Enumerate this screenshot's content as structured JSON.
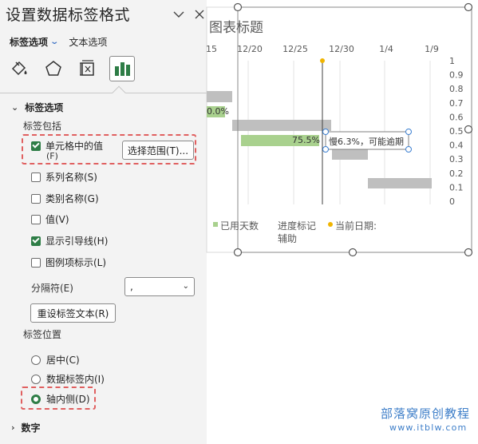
{
  "pane": {
    "title": "设置数据标签格式",
    "tabs": {
      "label_options": "标签选项",
      "text_options": "文本选项"
    },
    "icons": [
      "fill-line-icon",
      "effects-pentagon-icon",
      "size-properties-icon",
      "label-options-bar-icon"
    ],
    "section_label_options": "标签选项",
    "label_contains": "标签包括",
    "value_from_cells": {
      "label": "单元格中的值",
      "hotkey": "(F)",
      "checked": true
    },
    "select_range_button": "选择范围(T)...",
    "series_name": {
      "label": "系列名称(S)",
      "checked": false
    },
    "category_name": {
      "label": "类别名称(G)",
      "checked": false
    },
    "value": {
      "label": "值(V)",
      "checked": false
    },
    "show_leader_lines": {
      "label": "显示引导线(H)",
      "checked": true
    },
    "legend_key": {
      "label": "图例项标示(L)",
      "checked": false
    },
    "separator_label": "分隔符(E)",
    "separator_value": ",",
    "reset_button": "重设标签文本(R)",
    "label_position": "标签位置",
    "pos_center": {
      "label": "居中(C)",
      "selected": false
    },
    "pos_inside_end": {
      "label": "数据标签内(I)",
      "selected": false
    },
    "pos_inside_base": {
      "label": "轴内侧(D)",
      "selected": true
    },
    "section_number": "数字"
  },
  "chart": {
    "title": "图表标题",
    "label_75": "75.5%",
    "label_0": "0.0%",
    "callout": "慢6.3%，可能逾期",
    "legend": {
      "used_days": "已用天数",
      "progress_marker": "进度标记",
      "helper": "辅助",
      "current_date": "当前日期:"
    },
    "colors": {
      "green_bar": "#a9d18e",
      "gray_bar": "#bfbfbf",
      "today_marker": "#f0b400",
      "accent_green": "#2e7d46",
      "dash_red": "#e06060"
    }
  },
  "chart_data": {
    "type": "bar",
    "x_ticks": [
      "15",
      "12/20",
      "12/25",
      "12/30",
      "1/4",
      "1/9"
    ],
    "y_ticks": [
      "1",
      "0.9",
      "0.8",
      "0.7",
      "0.6",
      "0.5",
      "0.4",
      "0.3",
      "0.2",
      "0.1",
      "0"
    ],
    "ylim": [
      0,
      1
    ],
    "grid": "vertical"
  },
  "watermark": {
    "line1": "部落窝原创教程",
    "line2": "www.itblw.com"
  }
}
